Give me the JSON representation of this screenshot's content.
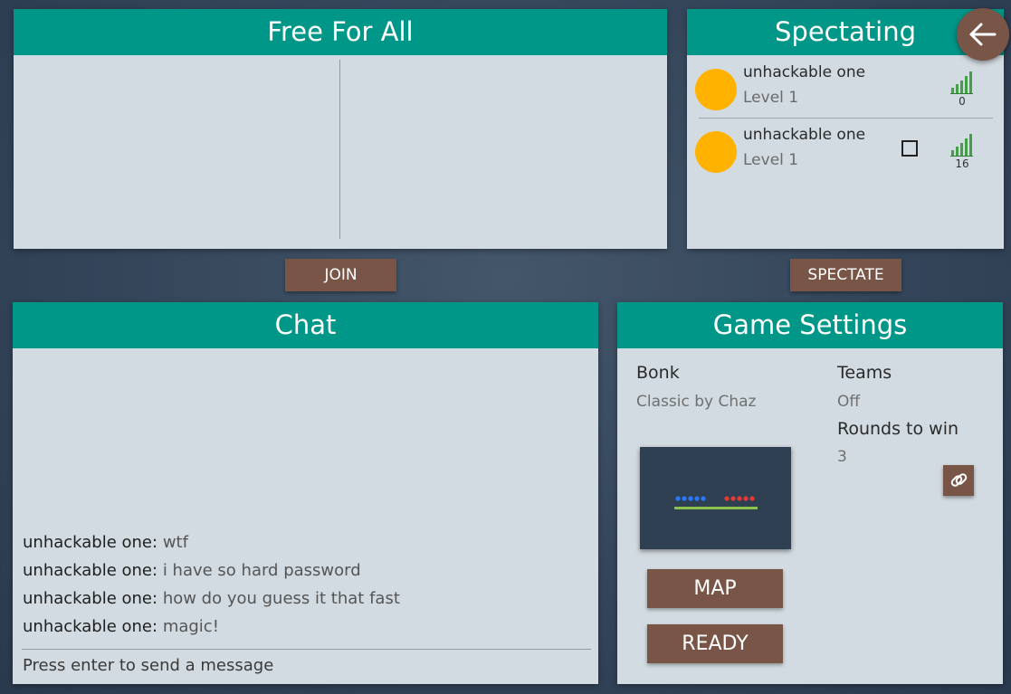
{
  "ffa": {
    "title": "Free For All",
    "join_label": "JOIN"
  },
  "spectating": {
    "title": "Spectating",
    "players": [
      {
        "name": "unhackable one",
        "level": "Level 1",
        "ping": "0",
        "checkbox": false
      },
      {
        "name": "unhackable one",
        "level": "Level 1",
        "ping": "16",
        "checkbox": true
      }
    ],
    "spectate_label": "SPECTATE"
  },
  "back_icon": "arrow-left-icon",
  "chat": {
    "title": "Chat",
    "messages": [
      {
        "who": "unhackable one",
        "text": "wtf"
      },
      {
        "who": "unhackable one",
        "text": "i have so hard password"
      },
      {
        "who": "unhackable one",
        "text": "how do you guess it that fast"
      },
      {
        "who": "unhackable one",
        "text": "magic!"
      }
    ],
    "separator": ": ",
    "input_placeholder": "Press enter to send a message"
  },
  "settings": {
    "title": "Game Settings",
    "mode_name": "Bonk",
    "map_name": "Classic by Chaz",
    "teams_label": "Teams",
    "teams_value": "Off",
    "rounds_label": "Rounds to win",
    "rounds_value": "3",
    "map_button": "MAP",
    "ready_button": "READY",
    "link_icon": "link-icon"
  },
  "colors": {
    "header": "#009688",
    "panel": "#d2dbe1",
    "button": "#795548",
    "avatar": "#ffb300",
    "ping_bars": "#43a047",
    "blue_team": "#2979ff",
    "red_team": "#e53935",
    "platform": "#8bc34a"
  }
}
